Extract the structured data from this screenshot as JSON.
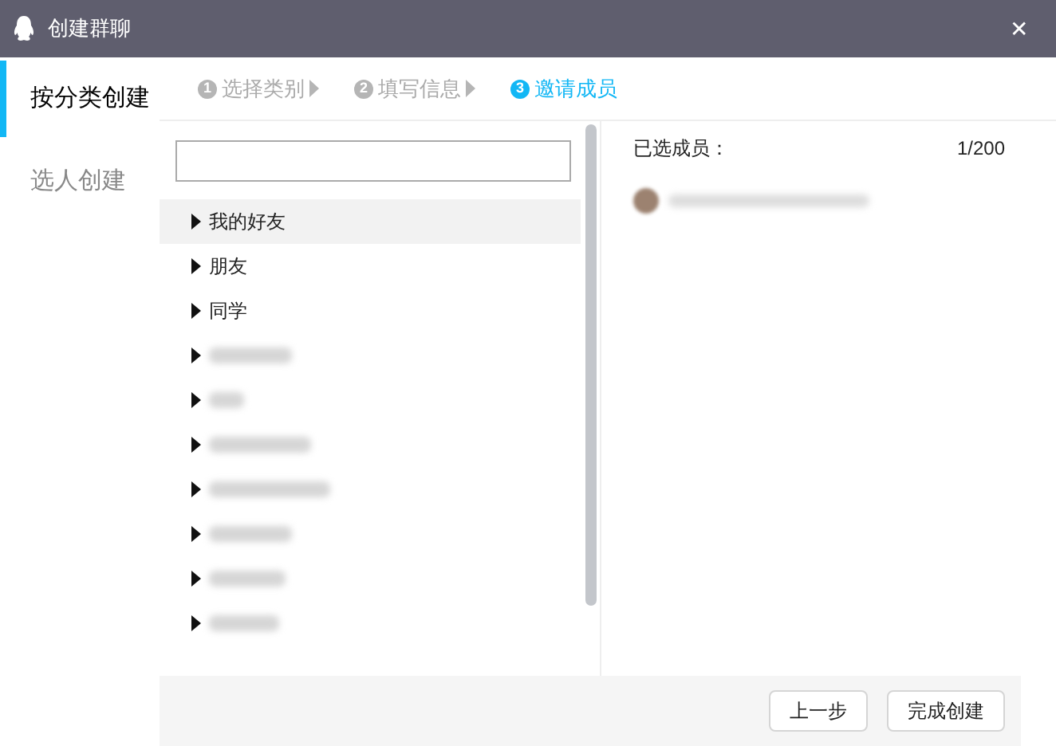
{
  "window": {
    "title": "创建群聊",
    "close": "✕"
  },
  "sidebar": {
    "items": [
      {
        "label": "按分类创建",
        "selected": true
      },
      {
        "label": "选人创建",
        "selected": false
      }
    ]
  },
  "steps": [
    {
      "number": "1",
      "label": "选择类别",
      "active": false,
      "arrow": true
    },
    {
      "number": "2",
      "label": "填写信息",
      "active": false,
      "arrow": true
    },
    {
      "number": "3",
      "label": "邀请成员",
      "active": true,
      "arrow": false
    }
  ],
  "groups": [
    {
      "kind": "named",
      "label": "我的好友",
      "selected": true
    },
    {
      "kind": "named",
      "label": "朋友",
      "selected": false
    },
    {
      "kind": "named",
      "label": "同学",
      "selected": false
    },
    {
      "kind": "blurred",
      "selected": false
    },
    {
      "kind": "blurred",
      "selected": false
    },
    {
      "kind": "blurred",
      "selected": false
    },
    {
      "kind": "blurred",
      "selected": false
    },
    {
      "kind": "blurred",
      "selected": false
    },
    {
      "kind": "blurred",
      "selected": false
    },
    {
      "kind": "blurred",
      "selected": false
    }
  ],
  "selected_members": {
    "label": "已选成员：",
    "count": "1/200",
    "members": [
      {
        "kind": "blurred"
      }
    ]
  },
  "buttons": [
    "上一步",
    "完成创建"
  ]
}
